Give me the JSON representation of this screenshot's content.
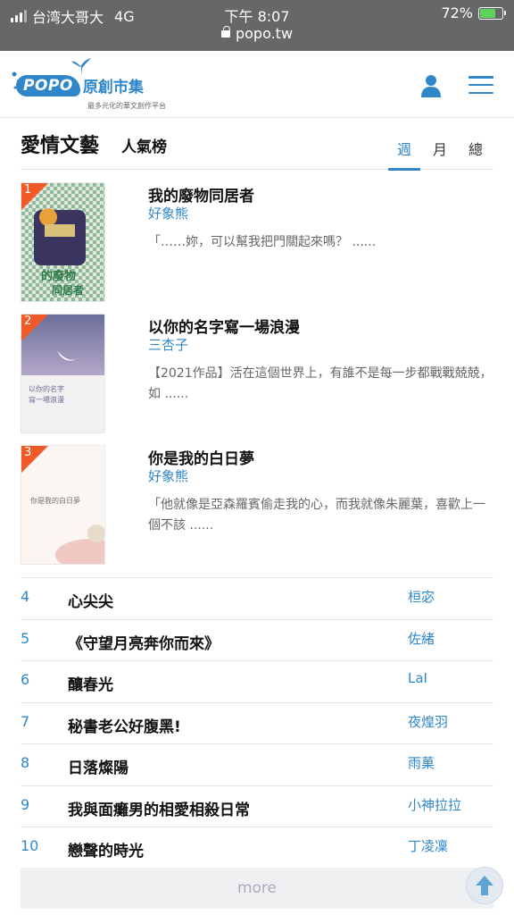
{
  "status_bar": {
    "carrier": "台湾大哥大",
    "network": "4G",
    "time": "下午 8:07",
    "url": "popo.tw",
    "battery": "72%"
  },
  "header": {
    "logo_text": "POPO",
    "logo_cn": "原創市集",
    "logo_tagline": "最多元化的華文創作平台"
  },
  "section": {
    "title": "愛情文藝",
    "subtitle": "人氣榜",
    "tabs": [
      {
        "label": "週",
        "active": true
      },
      {
        "label": "月",
        "active": false
      },
      {
        "label": "總",
        "active": false
      }
    ]
  },
  "featured": [
    {
      "rank": "1",
      "title": "我的廢物同居者",
      "author": "好象熊",
      "desc": "「……妳，可以幫我把門關起來嗎？ ......"
    },
    {
      "rank": "2",
      "title": "以你的名字寫一場浪漫",
      "author": "三杏子",
      "desc": "【2021作品】活在這個世界上，有誰不是每一步都戰戰兢兢，如 ......"
    },
    {
      "rank": "3",
      "title": "你是我的白日夢",
      "author": "好象熊",
      "desc": "「他就像是亞森羅賓偷走我的心，而我就像朱麗葉，喜歡上一個不該 ......"
    }
  ],
  "list": [
    {
      "rank": "4",
      "title": "心尖尖",
      "author": "桓宓"
    },
    {
      "rank": "5",
      "title": "《守望月亮奔你而來》",
      "author": "佐緒"
    },
    {
      "rank": "6",
      "title": "釀春光",
      "author": "LaI"
    },
    {
      "rank": "7",
      "title": "秘書老公好腹黑!",
      "author": "夜煌羽"
    },
    {
      "rank": "8",
      "title": "日落燦陽",
      "author": "雨菓"
    },
    {
      "rank": "9",
      "title": "我與面癱男的相愛相殺日常",
      "author": "小神拉拉"
    },
    {
      "rank": "10",
      "title": "戀聲的時光",
      "author": "丁凌凜"
    }
  ],
  "more_label": "more",
  "colors": {
    "accent": "#2f87c9",
    "badge": "#f05a28"
  },
  "icons": [
    "user-icon",
    "menu-icon",
    "scroll-top-arrow-icon"
  ]
}
